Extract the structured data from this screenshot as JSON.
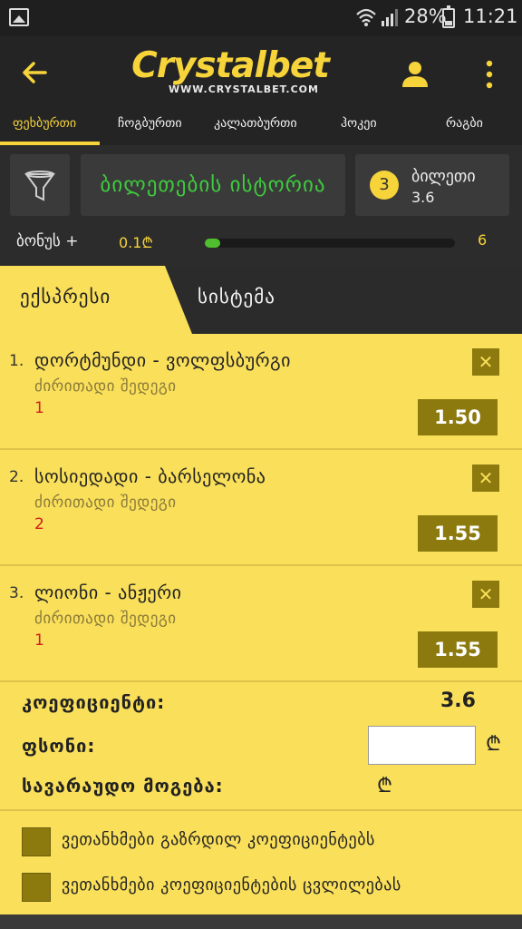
{
  "status_bar": {
    "battery": "28%",
    "time": "11:21"
  },
  "app_bar": {
    "logo_text": "Crystalbet",
    "logo_url": "WWW.CRYSTALBET.COM"
  },
  "sport_tabs": [
    {
      "label": "ფეხბურთი",
      "active": true
    },
    {
      "label": "ჩოგბურთი",
      "active": false
    },
    {
      "label": "კალათბურთი",
      "active": false
    },
    {
      "label": "ჰოკეი",
      "active": false
    },
    {
      "label": "რაგბი",
      "active": false
    }
  ],
  "panel": {
    "history_label": "ბილეთების ისტორია",
    "tickets_count": "3",
    "tickets_label": "ბილეთი",
    "tickets_odds": "3.6"
  },
  "bonus": {
    "label": "ბონუს +",
    "min": "0.1₾",
    "max": "6",
    "progress_fraction": 0.06
  },
  "bet_types": {
    "express": "ექსპრესი",
    "system": "სისტემა"
  },
  "bets": [
    {
      "num": "1.",
      "teams": "დორტმუნდი - ვოლფსბურგი",
      "market": "ძირითადი შედეგი",
      "outcome": "1",
      "odds": "1.50",
      "remove": "✕"
    },
    {
      "num": "2.",
      "teams": "სოსიედადი - ბარსელონა",
      "market": "ძირითადი შედეგი",
      "outcome": "2",
      "odds": "1.55",
      "remove": "✕"
    },
    {
      "num": "3.",
      "teams": "ლიონი - ანჟერი",
      "market": "ძირითადი შედეგი",
      "outcome": "1",
      "odds": "1.55",
      "remove": "✕"
    }
  ],
  "summary": {
    "coef_label": "კოეფიციენტი:",
    "coef_value": "3.6",
    "stake_label": "ფსონი:",
    "stake_value": "",
    "win_label": "სავარაუდო მოგება:",
    "currency": "₾"
  },
  "options": [
    {
      "label": "ვეთანხმები გაზრდილ კოეფიციენტებს"
    },
    {
      "label": "ვეთანხმები კოეფიციენტების ცვლილებას"
    }
  ],
  "colors": {
    "accent": "#f6d43a",
    "panel_bg": "#f9df5a",
    "dark_bg": "#242424",
    "history_green": "#3ecb3e",
    "odds_bg": "#8c7a0f",
    "outcome_red": "#d21c1c"
  }
}
